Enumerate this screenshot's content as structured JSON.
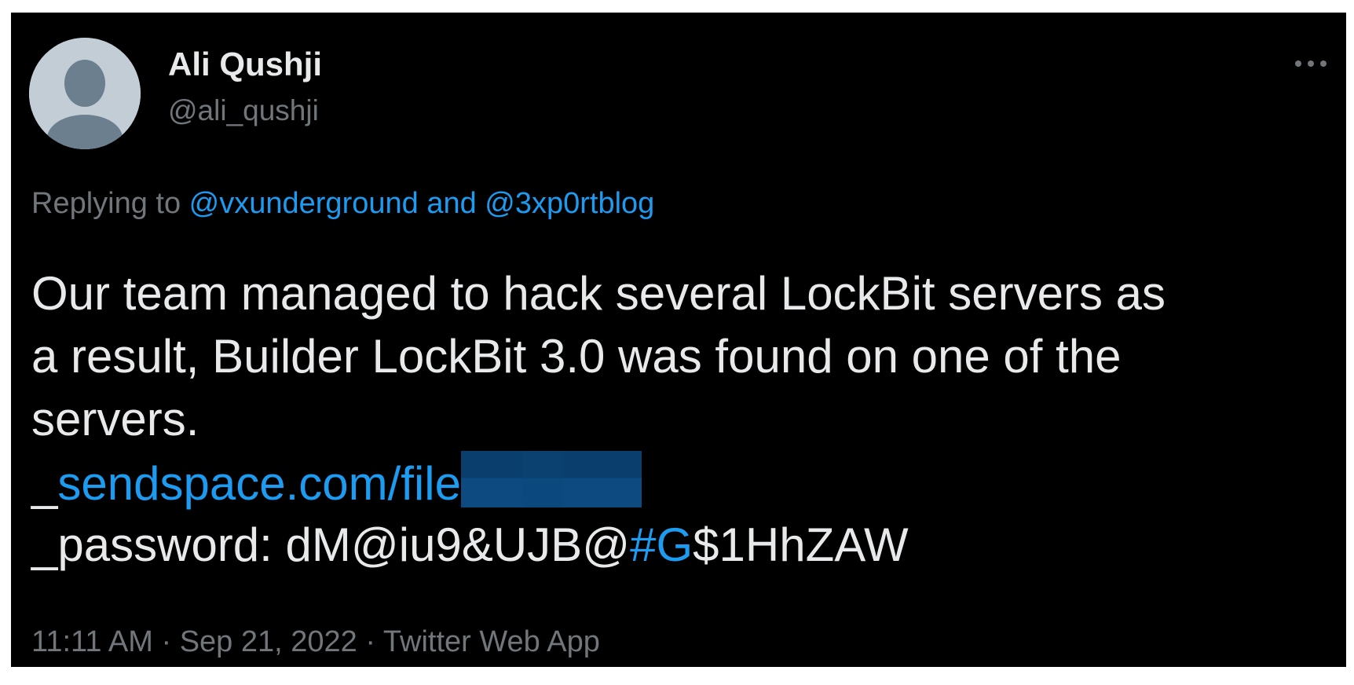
{
  "author": {
    "name": "Ali Qushji",
    "handle": "@ali_qushji"
  },
  "more_icon": "more-horizontal-icon",
  "reply": {
    "prefix": "Replying to ",
    "mentions": "@vxunderground and @3xp0rtblog"
  },
  "body": {
    "line1": "Our team managed to hack several LockBit servers as",
    "line2": "a result, Builder LockBit 3.0 was found on one of the",
    "line3": "servers.",
    "link_prefix": "_",
    "link_text": "sendspace.com/file",
    "password_prefix": "_password: dM@iu9&UJB@",
    "password_hashtag": "#G",
    "password_suffix": "$1HhZAW"
  },
  "meta": {
    "time": "11:11 AM",
    "sep1": " · ",
    "date": "Sep 21, 2022",
    "sep2": " · ",
    "source": "Twitter Web App"
  },
  "colors": {
    "background": "#000000",
    "text": "#e7e9ea",
    "secondary": "#71767b",
    "link": "#1d9bf0"
  }
}
